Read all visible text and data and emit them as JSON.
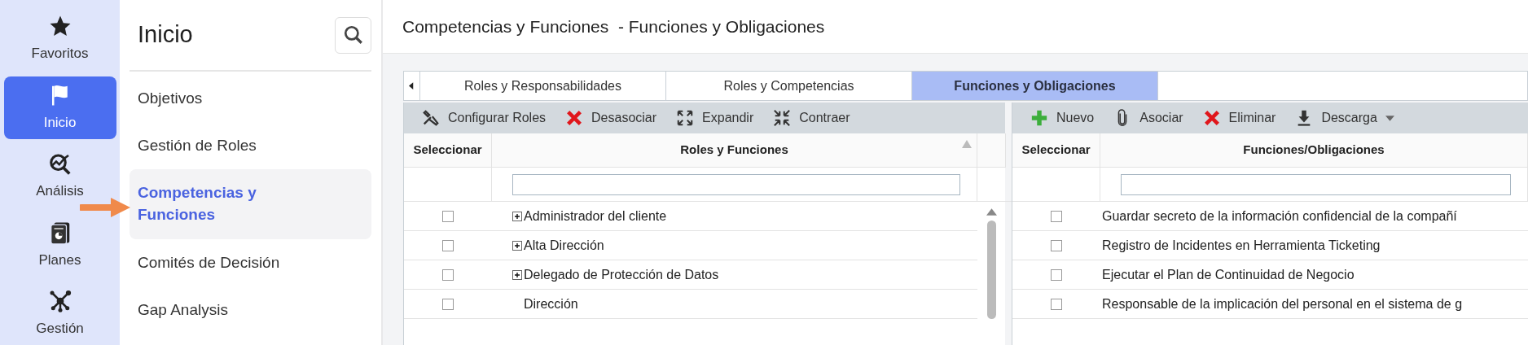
{
  "rail": [
    {
      "label": "Favoritos",
      "kind": "star",
      "selected": false
    },
    {
      "label": "Inicio",
      "kind": "flag",
      "selected": true
    },
    {
      "label": "Análisis",
      "kind": "analysis",
      "selected": false
    },
    {
      "label": "Planes",
      "kind": "plans",
      "selected": false
    },
    {
      "label": "Gestión",
      "kind": "network",
      "selected": false
    }
  ],
  "sidebar": {
    "title": "Inicio",
    "items": [
      {
        "label": "Objetivos",
        "selected": false
      },
      {
        "label": "Gestión de Roles",
        "selected": false
      },
      {
        "label": "Competencias y Funciones",
        "selected": true
      },
      {
        "label": "Comités de Decisión",
        "selected": false
      },
      {
        "label": "Gap Analysis",
        "selected": false
      }
    ]
  },
  "page_title": "Competencias y Funciones  - Funciones y Obligaciones",
  "tabs": [
    {
      "label": "Roles y Responsabilidades",
      "selected": false
    },
    {
      "label": "Roles y Competencias",
      "selected": false
    },
    {
      "label": "Funciones y Obligaciones",
      "selected": true
    }
  ],
  "left_pane": {
    "toolbar": [
      {
        "label": "Configurar Roles",
        "kind": "tools"
      },
      {
        "label": "Desasociar",
        "kind": "remove"
      },
      {
        "label": "Expandir",
        "kind": "expand"
      },
      {
        "label": "Contraer",
        "kind": "collapse"
      }
    ],
    "columns": [
      "Seleccionar",
      "Roles y Funciones"
    ],
    "rows": [
      {
        "label": "Administrador del cliente",
        "checked": false,
        "expandable": true
      },
      {
        "label": "Alta Dirección",
        "checked": false,
        "expandable": true
      },
      {
        "label": "Delegado de Protección de Datos",
        "checked": false,
        "expandable": true
      },
      {
        "label": "Dirección",
        "checked": false,
        "expandable": false
      }
    ]
  },
  "right_pane": {
    "toolbar": [
      {
        "label": "Nuevo",
        "kind": "add"
      },
      {
        "label": "Asociar",
        "kind": "attach"
      },
      {
        "label": "Eliminar",
        "kind": "remove"
      },
      {
        "label": "Descarga",
        "kind": "download"
      }
    ],
    "columns": [
      "Seleccionar",
      "Funciones/Obligaciones"
    ],
    "rows": [
      {
        "label": "Guardar secreto de la información confidencial de la compañí",
        "checked": false
      },
      {
        "label": "Registro de Incidentes en Herramienta Ticketing",
        "checked": false
      },
      {
        "label": "Ejecutar el Plan de Continuidad de Negocio",
        "checked": false
      },
      {
        "label": "Responsable de la implicación del personal en el sistema de g",
        "checked": false
      }
    ]
  }
}
